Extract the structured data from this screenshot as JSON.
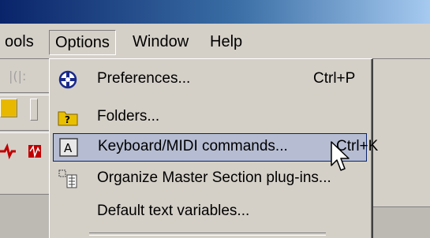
{
  "menubar": {
    "items": [
      {
        "label": "ools"
      },
      {
        "label": "Options"
      },
      {
        "label": "Window"
      },
      {
        "label": "Help"
      }
    ]
  },
  "options_menu": {
    "items": [
      {
        "label": "Preferences...",
        "shortcut": "Ctrl+P",
        "icon": "preferences-icon",
        "mnemonic": "P"
      },
      {
        "label": "Folders...",
        "shortcut": "",
        "icon": "folder-help-icon",
        "mnemonic": "F"
      },
      {
        "label": "Keyboard/MIDI commands...",
        "shortcut": "Ctrl+K",
        "icon": "keyboard-icon",
        "mnemonic": "K",
        "highlighted": true
      },
      {
        "label": "Organize Master Section plug-ins...",
        "shortcut": "",
        "icon": "organize-plugins-icon",
        "mnemonic": "O"
      },
      {
        "label": "Default text variables...",
        "shortcut": "",
        "icon": "",
        "mnemonic": "D"
      }
    ]
  },
  "colors": {
    "menu_bg": "#d4d0c8",
    "highlight_bg": "#b6bdd2",
    "highlight_border": "#0a246a",
    "titlebar_start": "#0a246a",
    "titlebar_end": "#a6caf0"
  }
}
